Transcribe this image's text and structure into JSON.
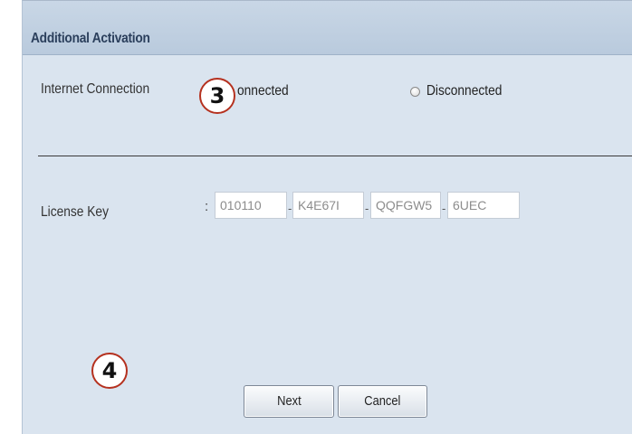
{
  "panel": {
    "title": "Additional Activation"
  },
  "internet_connection": {
    "label": "Internet Connection",
    "options": [
      {
        "label": "Connected",
        "visible_text": "onnected"
      },
      {
        "label": "Disconnected",
        "visible_text": "Disconnected"
      }
    ]
  },
  "license": {
    "label": "License Key",
    "separator": ":",
    "segments": [
      "010110",
      "K4E67I",
      "QQFGW5",
      "6UEC"
    ],
    "dash": "-"
  },
  "buttons": {
    "next": "Next",
    "cancel": "Cancel"
  },
  "annotations": {
    "step_3": "3",
    "step_4": "4",
    "badge_color": "#b5311f"
  },
  "colors": {
    "panel_bg": "#dae4ef",
    "header_bg": "#c0d0e2",
    "title_text": "#2b3f5c"
  }
}
